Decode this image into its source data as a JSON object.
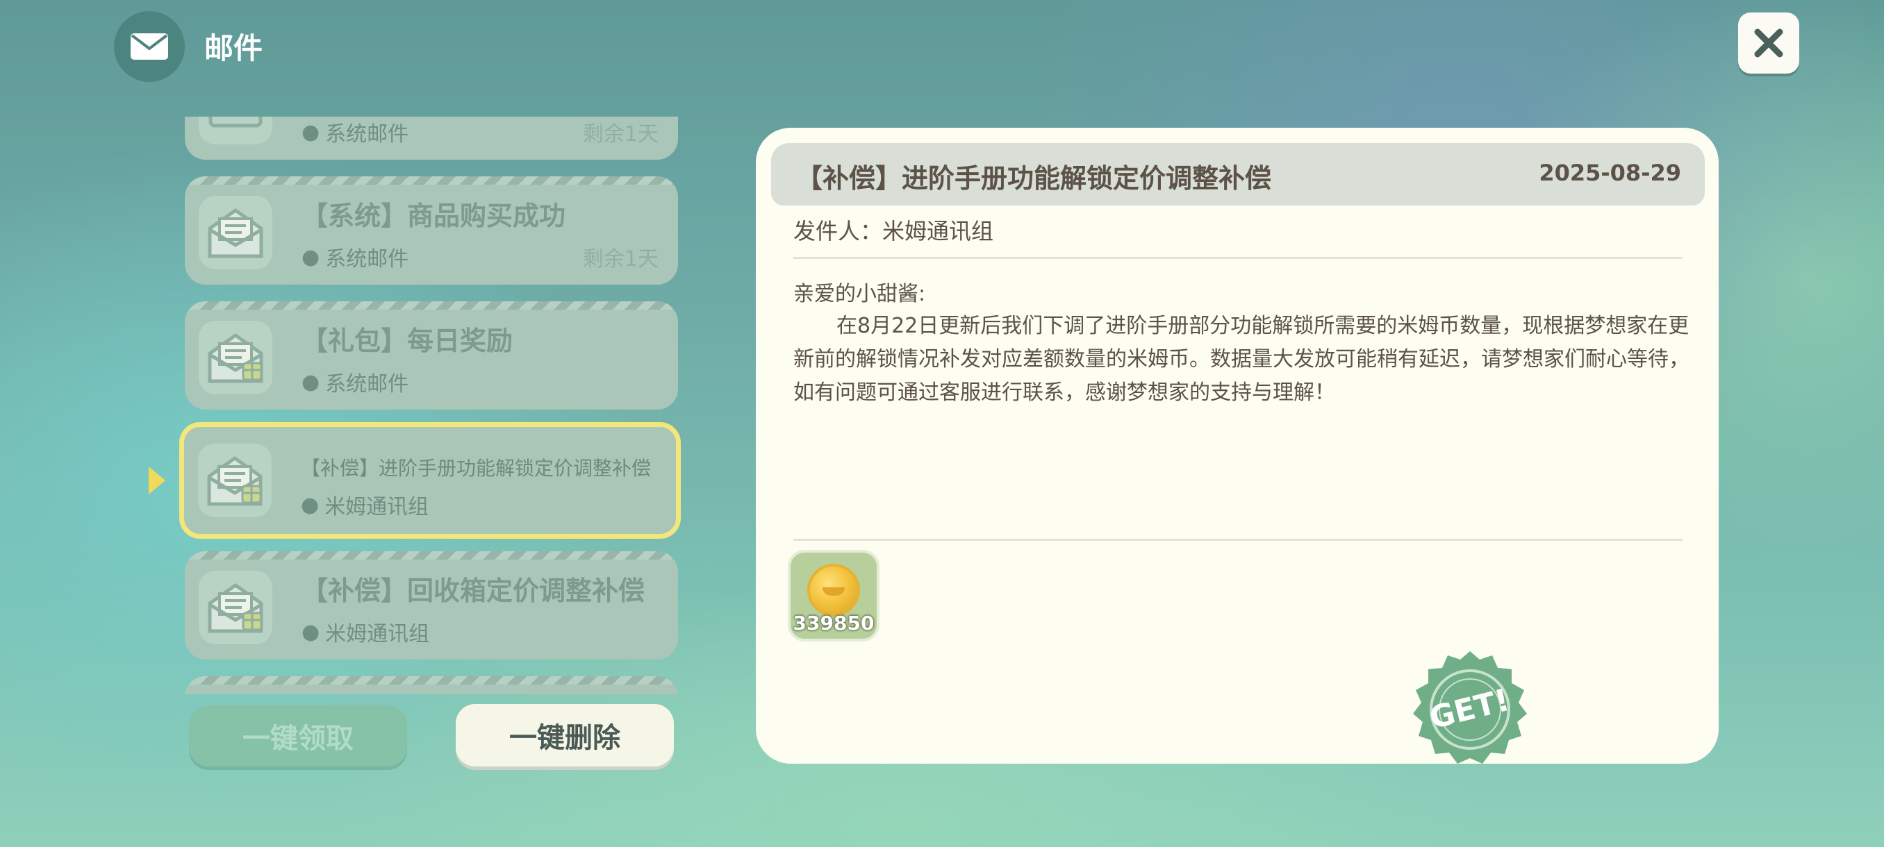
{
  "header": {
    "title": "邮件",
    "icon": "mail-icon"
  },
  "mail_list": [
    {
      "title": "",
      "sender": "系统邮件",
      "expire": "剩余1天",
      "icon": "envelope-icon"
    },
    {
      "title": "【系统】商品购买成功",
      "sender": "系统邮件",
      "expire": "剩余1天",
      "icon": "open-envelope-letter-icon"
    },
    {
      "title": "【礼包】每日奖励",
      "sender": "系统邮件",
      "expire": "",
      "icon": "gift-envelope-icon"
    },
    {
      "title": "【补偿】进阶手册功能解锁定价调整补偿",
      "sender": "米姆通讯组",
      "expire": "",
      "icon": "gift-envelope-icon",
      "selected": true
    },
    {
      "title": "【补偿】回收箱定价调整补偿",
      "sender": "米姆通讯组",
      "expire": "",
      "icon": "gift-envelope-icon"
    }
  ],
  "buttons": {
    "claim_all": "一键领取",
    "delete_all": "一键删除"
  },
  "detail": {
    "title": "【补偿】进阶手册功能解锁定价调整补偿",
    "date": "2025-08-29",
    "sender": "发件人：米姆通讯组",
    "greeting": "亲爱的小甜酱:",
    "body": "在8月22日更新后我们下调了进阶手册部分功能解锁所需要的米姆币数量，现根据梦想家在更新前的解锁情况补发对应差额数量的米姆币。数据量大发放可能稍有延迟，请梦想家们耐心等待，如有问题可通过客服进行联系，感谢梦想家的支持与理解！",
    "reward": {
      "count": "339850",
      "icon": "mim-coin-icon"
    },
    "stamp": "GET!"
  },
  "colors": {
    "accent_selected": "#f3e67a",
    "panel_bg": "#fdfdf2",
    "stamp_green": "#6fae86"
  }
}
